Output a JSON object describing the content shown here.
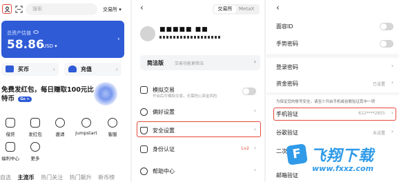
{
  "colors": {
    "accent": "#2f5bd6",
    "highlight": "#e5483a",
    "watermark": "#2f9ae8"
  },
  "panel1": {
    "search": {
      "placeholder": "搜索"
    },
    "exchange_select": "交易所 ▾",
    "asset": {
      "label": "总资产估值",
      "value": "58.86",
      "unit": "USD ▾"
    },
    "quick_actions": [
      {
        "label": "买币",
        "icon": "buy-coin-icon"
      },
      {
        "label": "充值",
        "icon": "deposit-icon"
      }
    ],
    "promo": {
      "text": "免费发红包，每日赚取100元比特币",
      "badge": "Go >"
    },
    "grid": [
      {
        "label": "借贷",
        "icon": "loan-icon"
      },
      {
        "label": "发红包",
        "icon": "red-packet-icon"
      },
      {
        "label": "邀请",
        "icon": "invite-icon"
      },
      {
        "label": "Jumpstart",
        "icon": "jumpstart-icon"
      },
      {
        "label": "客服",
        "icon": "support-icon"
      },
      {
        "label": "福利中心",
        "icon": "rewards-icon"
      },
      {
        "label": "更多",
        "icon": "more-icon"
      }
    ],
    "tabs": [
      "自选",
      "主流币",
      "热门关注",
      "热门飙升",
      "新币榜"
    ]
  },
  "panel2": {
    "segment": {
      "active": "交易所",
      "inactive": "MetaX"
    },
    "user": {
      "name": "■■■■■ ■■"
    },
    "simple_mode": {
      "title": "简洁版",
      "desc": "交易功能更简洁"
    },
    "rows": [
      {
        "label": "模拟交易",
        "sub": "开启后可模拟交易，无需担心资金风险",
        "icon": "demo-trading-icon",
        "control": "toggle"
      },
      {
        "label": "偏好设置",
        "icon": "preferences-icon",
        "control": "arrow"
      },
      {
        "label": "安全设置",
        "icon": "security-shield-icon",
        "control": "arrow"
      },
      {
        "label": "身份认证",
        "icon": "identity-icon",
        "control": "arrow",
        "badge": "Lv2"
      },
      {
        "label": "帮助中心",
        "icon": "help-center-icon",
        "control": "arrow"
      }
    ]
  },
  "panel3": {
    "rows_a": [
      {
        "label": "面容ID",
        "control": "toggle"
      },
      {
        "label": "手势密码",
        "control": "toggle"
      }
    ],
    "rows_b": [
      {
        "label": "登录密码",
        "value": ""
      },
      {
        "label": "资金密码",
        "value": "已设置"
      }
    ],
    "note": "为保证您的账号安全，请至少开启手机或谷歌验证其中一项",
    "rows_c": [
      {
        "label": "手机验证",
        "value": "612****2855"
      },
      {
        "label": "谷歌验证",
        "value": "未设置"
      },
      {
        "label": "二次验证",
        "value": ""
      },
      {
        "label": "邮箱验证",
        "value": ""
      }
    ]
  },
  "watermark": {
    "title": "飞翔下载",
    "url": "www.fxxz.com"
  }
}
